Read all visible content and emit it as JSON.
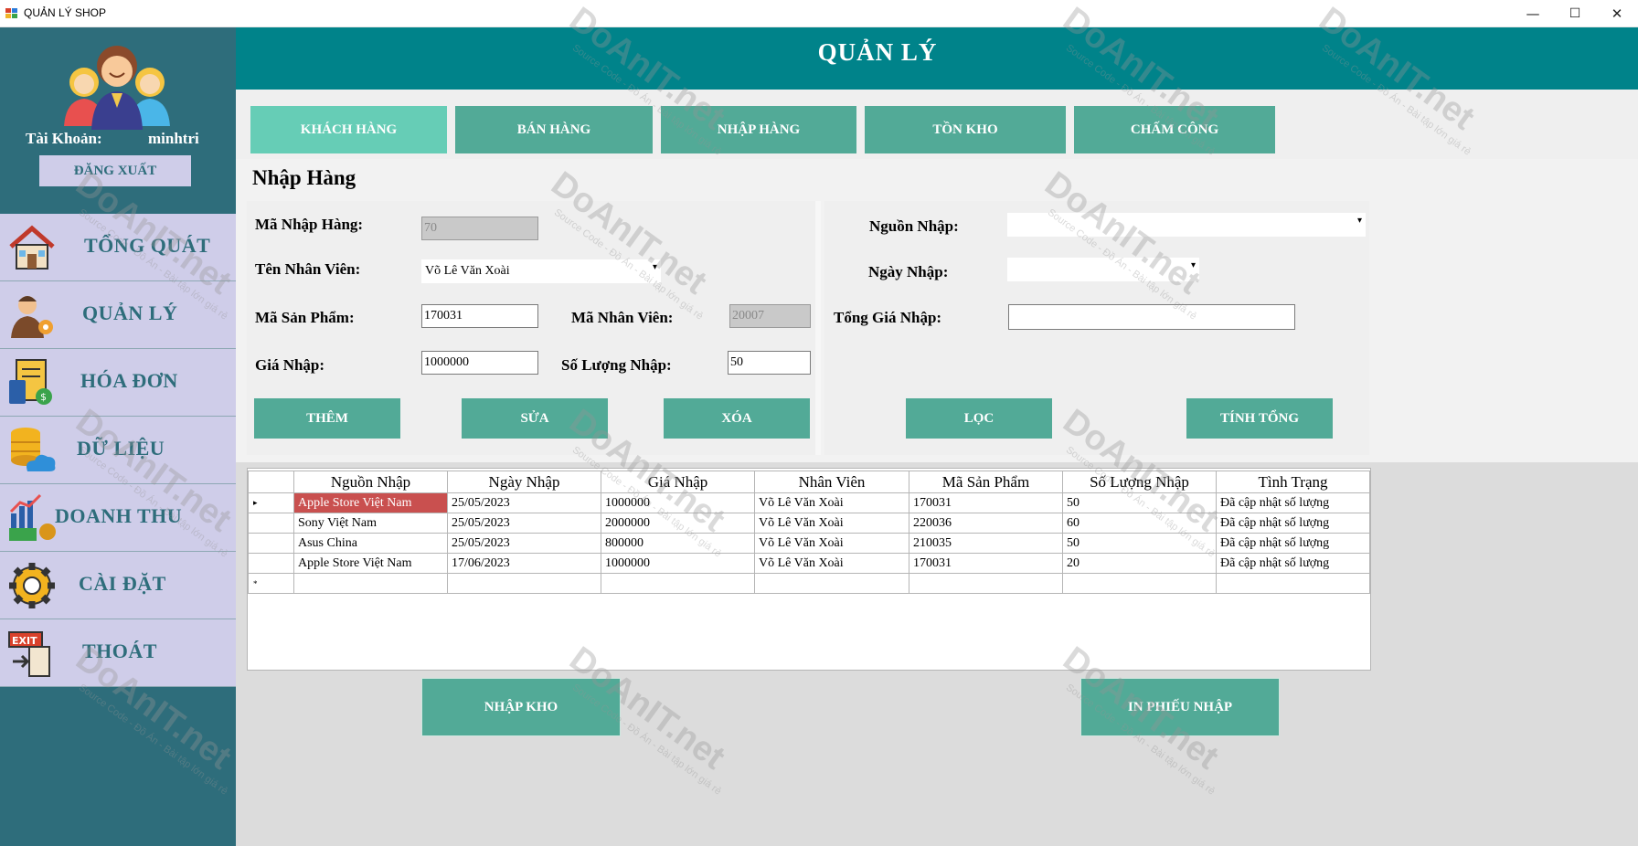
{
  "window": {
    "title": "QUẢN LÝ SHOP",
    "minimize": "—",
    "maximize": "☐",
    "close": "✕"
  },
  "sidebar": {
    "account_label": "Tài Khoản:",
    "account_value": "minhtri",
    "logout": "ĐĂNG XUẤT",
    "items": [
      {
        "label": "TỔNG QUÁT",
        "icon": "house-icon"
      },
      {
        "label": "QUẢN LÝ",
        "icon": "manager-icon"
      },
      {
        "label": "HÓA ĐƠN",
        "icon": "invoice-icon"
      },
      {
        "label": "DỮ LIỆU",
        "icon": "database-cloud-icon"
      },
      {
        "label": "DOANH THU",
        "icon": "revenue-chart-icon"
      },
      {
        "label": "CÀI ĐẶT",
        "icon": "gear-icon"
      },
      {
        "label": "THOÁT",
        "icon": "exit-icon"
      }
    ]
  },
  "header": {
    "title": "QUẢN LÝ"
  },
  "tabs": [
    {
      "label": "KHÁCH HÀNG"
    },
    {
      "label": "BÁN HÀNG"
    },
    {
      "label": "NHẬP HÀNG"
    },
    {
      "label": "TỒN KHO"
    },
    {
      "label": "CHẤM CÔNG"
    }
  ],
  "form": {
    "section_title": "Nhập Hàng",
    "ma_nhap_hang_label": "Mã Nhập Hàng:",
    "ma_nhap_hang_value": "70",
    "ten_nhan_vien_label": "Tên Nhân Viên:",
    "ten_nhan_vien_value": "Võ Lê Văn Xoài",
    "ma_san_pham_label": "Mã Sản Phẩm:",
    "ma_san_pham_value": "170031",
    "ma_nhan_vien_label": "Mã Nhân Viên:",
    "ma_nhan_vien_value": "20007",
    "gia_nhap_label": "Giá Nhập:",
    "gia_nhap_value": "1000000",
    "so_luong_nhap_label": "Số Lượng Nhập:",
    "so_luong_nhap_value": "50",
    "nguon_nhap_label": "Nguồn Nhập:",
    "nguon_nhap_value": "",
    "ngay_nhap_label": "Ngày Nhập:",
    "ngay_nhap_value": "",
    "tong_gia_nhap_label": "Tổng Giá Nhập:",
    "tong_gia_nhap_value": ""
  },
  "actions": {
    "them": "THÊM",
    "sua": "SỬA",
    "xoa": "XÓA",
    "loc": "LỌC",
    "tinh_tong": "TÍNH TỔNG"
  },
  "grid": {
    "columns": [
      "Nguồn Nhập",
      "Ngày Nhập",
      "Giá Nhập",
      "Nhân Viên",
      "Mã Sản Phẩm",
      "Số Lượng Nhập",
      "Tình Trạng"
    ],
    "rows": [
      [
        "Apple Store Việt Nam",
        "25/05/2023",
        "1000000",
        "Võ Lê Văn Xoài",
        "170031",
        "50",
        "Đã cập nhật số lượng"
      ],
      [
        "Sony Việt Nam",
        "25/05/2023",
        "2000000",
        "Võ Lê Văn Xoài",
        "220036",
        "60",
        "Đã cập nhật số lượng"
      ],
      [
        "Asus China",
        "25/05/2023",
        "800000",
        "Võ Lê Văn Xoài",
        "210035",
        "50",
        "Đã cập nhật số lượng"
      ],
      [
        "Apple Store Việt Nam",
        "17/06/2023",
        "1000000",
        "Võ Lê Văn Xoài",
        "170031",
        "20",
        "Đã cập nhật số lượng"
      ]
    ],
    "current_row_marker": "▸",
    "new_row_marker": "*"
  },
  "bottom": {
    "nhap_kho": "NHẬP KHO",
    "in_phieu_nhap": "IN PHIẾU NHẬP"
  },
  "watermark": {
    "brand": "DoAnIT.net",
    "tagline": "Source Code - Đồ Án - Bài tập lớn giá rẻ"
  },
  "colors": {
    "sidebar": "#2e6d7b",
    "header": "#00838a",
    "button": "#52aa97",
    "active_tab": "#66cdb6",
    "nav_item": "#cfcde9",
    "selected_cell": "#c9504f"
  }
}
